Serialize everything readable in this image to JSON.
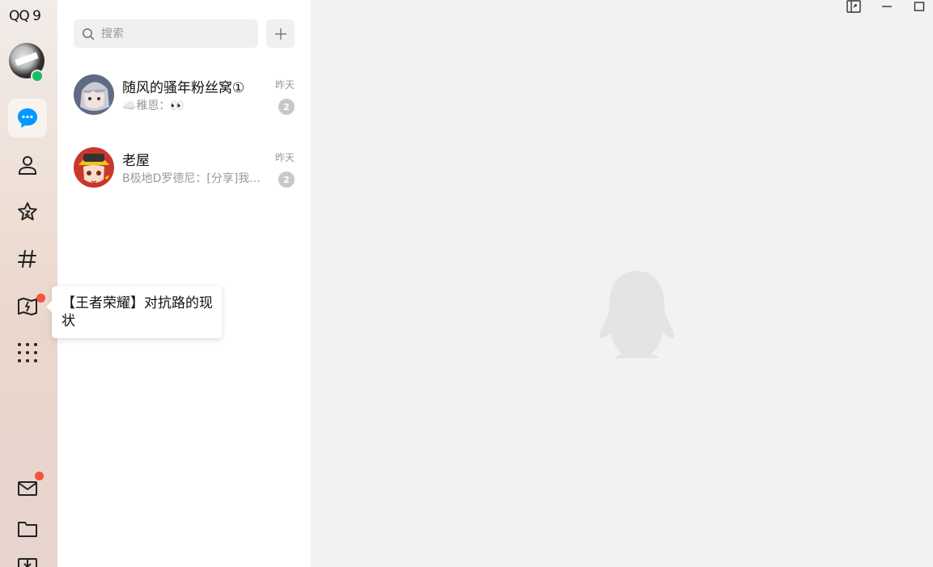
{
  "app": {
    "brand": "QQ 9"
  },
  "nav": {
    "items": [
      {
        "name": "messages",
        "active": true
      },
      {
        "name": "contacts"
      },
      {
        "name": "favorites"
      },
      {
        "name": "channels"
      },
      {
        "name": "games",
        "has_dot": true
      },
      {
        "name": "apps"
      }
    ],
    "bottom": [
      {
        "name": "mail",
        "has_dot": true
      },
      {
        "name": "folder"
      },
      {
        "name": "more"
      }
    ]
  },
  "search": {
    "placeholder": "搜索"
  },
  "conversations": [
    {
      "name": "随风的骚年粉丝窝①",
      "time": "昨天",
      "message": "☁️稚恩：👀",
      "unread": "2"
    },
    {
      "name": "老屋",
      "time": "昨天",
      "message": "B极地D罗德尼：[分享]我...",
      "unread": "2"
    }
  ],
  "tooltip": {
    "text": "【王者荣耀】对抗路的现状"
  },
  "colors": {
    "accent": "#0099ff",
    "online": "#16c060",
    "notify": "#f4533f"
  }
}
